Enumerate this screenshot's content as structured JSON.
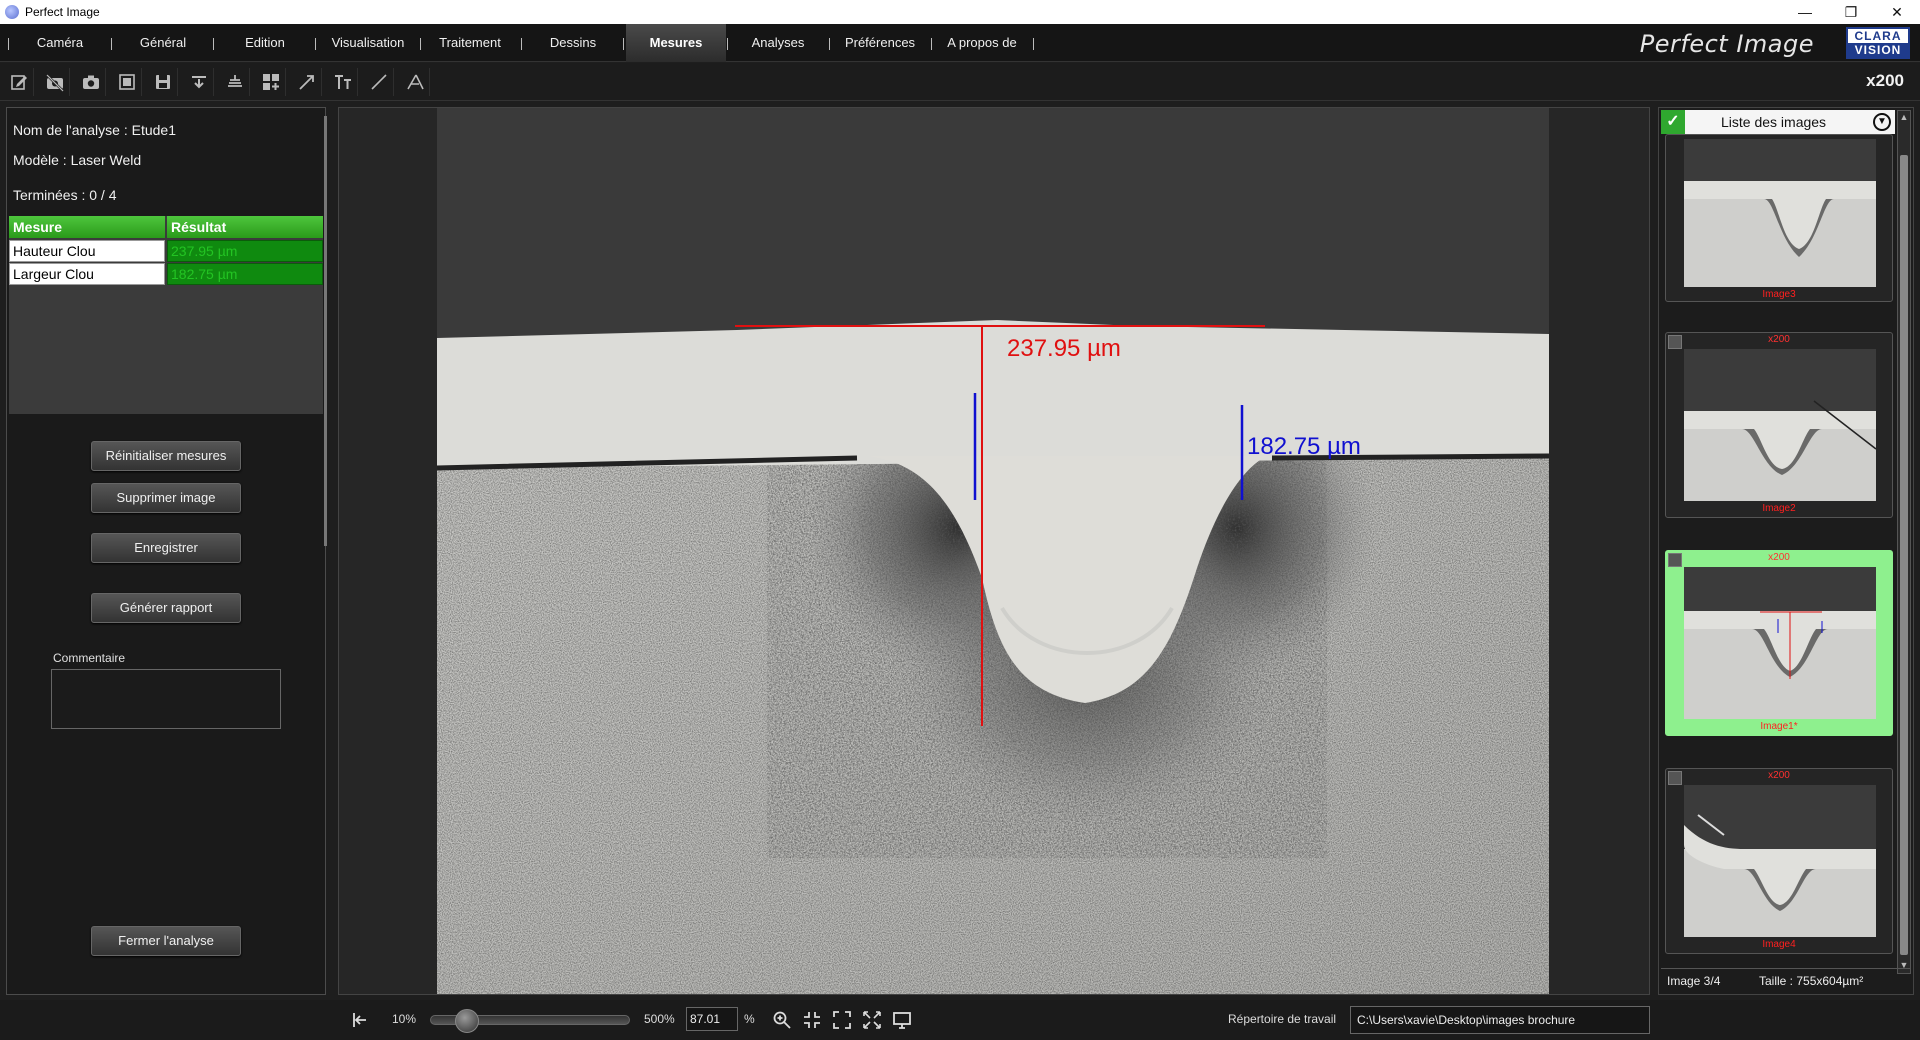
{
  "window": {
    "title": "Perfect Image"
  },
  "menu": {
    "items": [
      "Caméra",
      "Général",
      "Edition",
      "Visualisation",
      "Traitement",
      "Dessins",
      "Mesures",
      "Analyses",
      "Préférences",
      "A propos de"
    ],
    "active": "Mesures"
  },
  "brand": {
    "title": "Perfect Image",
    "logo_top": "CLARA",
    "logo_bottom": "VISION"
  },
  "toolbar": {
    "tools": [
      "edit-icon",
      "camera-off-icon",
      "camera-icon",
      "gallery-icon",
      "save-icon",
      "move-down-icon",
      "layers-icon",
      "grid-add-icon",
      "arrow-icon",
      "text-icon",
      "line-icon",
      "angle-icon"
    ],
    "zoom_label": "x200"
  },
  "analysis": {
    "name_label": "Nom de l'analyse : Etude1",
    "model_label": "Modèle : Laser Weld",
    "completed_label": "Terminées : 0 / 4",
    "table": {
      "headers": [
        "Mesure",
        "Résultat"
      ],
      "rows": [
        {
          "name": "Hauteur Clou",
          "value": "237.95 µm"
        },
        {
          "name": "Largeur Clou",
          "value": "182.75 µm"
        }
      ]
    },
    "buttons": {
      "reset": "Réinitialiser mesures",
      "delete": "Supprimer image",
      "save": "Enregistrer",
      "report": "Générer rapport",
      "close": "Fermer l'analyse"
    },
    "comment_label": "Commentaire",
    "comment_value": ""
  },
  "viewer": {
    "measure_height": "237.95 µm",
    "measure_width": "182.75 µm",
    "colors": {
      "height": "#e01010",
      "width": "#1010d0"
    }
  },
  "image_list": {
    "title": "Liste des images",
    "thumbnails": [
      {
        "name": "Image3",
        "mag": "",
        "selected": false
      },
      {
        "name": "Image2",
        "mag": "x200",
        "selected": false
      },
      {
        "name": "Image1*",
        "mag": "x200",
        "selected": true
      },
      {
        "name": "Image4",
        "mag": "x200",
        "selected": false
      }
    ],
    "footer_image": "Image  3/4",
    "footer_size": "Taille :  755x604µm²"
  },
  "statusbar": {
    "zoom_min": "10%",
    "zoom_max": "500%",
    "zoom_value": "87.01",
    "zoom_unit": "%",
    "workdir_label": "Répertoire de travail",
    "workdir_path": "C:\\Users\\xavie\\Desktop\\images brochure"
  }
}
